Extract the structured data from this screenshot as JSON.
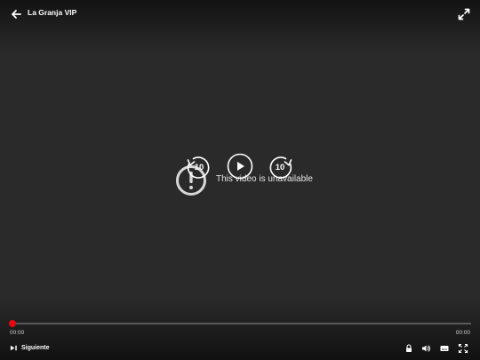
{
  "header": {
    "title": "La Granja VIP",
    "back_icon": "arrow-left-icon",
    "expand_icon": "expand-diagonal-icon"
  },
  "player": {
    "message": "This video is unavailable",
    "warning_icon": "alert-circle-icon",
    "controls": {
      "rewind_label": "10",
      "forward_label": "10",
      "play_icon": "play-icon"
    }
  },
  "progress": {
    "current_time": "00:00",
    "duration": "00:00",
    "fraction": 0
  },
  "footer": {
    "next_label": "Siguiente",
    "icons": [
      "lock-icon",
      "volume-icon",
      "subtitles-icon",
      "fullscreen-icon"
    ]
  },
  "colors": {
    "background": "#2a2a2a",
    "accent": "#e50914",
    "text": "#ffffff"
  }
}
